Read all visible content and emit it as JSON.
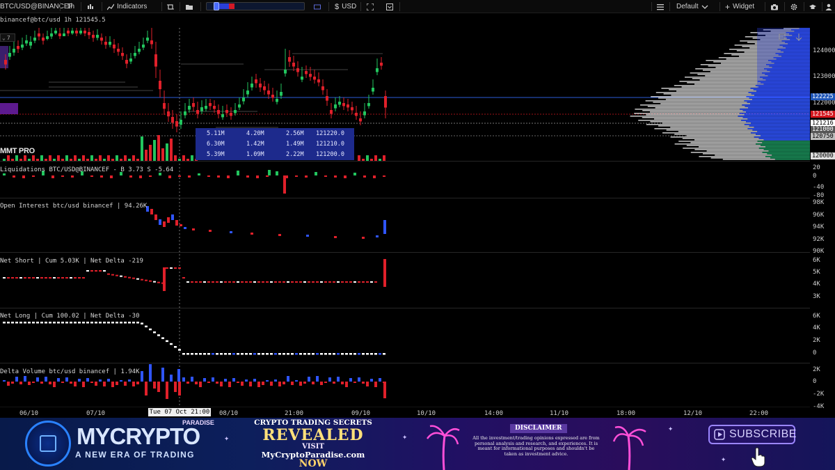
{
  "toolbar": {
    "symbol": "BTC/USD@BINANCEF",
    "interval": "1h",
    "indicators_label": "Indicators",
    "currency_label": "USD",
    "layout_label": "Default",
    "widget_label": "Widget"
  },
  "chart_header": {
    "symbol_line": "binancef@btc/usd 1h 121545.5",
    "collapse_count": "7",
    "watermark": "MMT PRO"
  },
  "price_axis": {
    "ticks": [
      "124000",
      "123000",
      "122000",
      "120000"
    ],
    "tags": [
      {
        "value": "122225",
        "bg": "#1f56b8",
        "fg": "#ffffff"
      },
      {
        "value": "121545",
        "bg": "#d4161e",
        "fg": "#ffffff"
      },
      {
        "value": "121216",
        "bg": "#ffffff",
        "fg": "#000000"
      },
      {
        "value": "121000",
        "bg": "#555555",
        "fg": "#ffffff"
      },
      {
        "value": "120750",
        "bg": "#bbbbbb",
        "fg": "#000000"
      },
      {
        "value": "120000",
        "bg": "#dddddd",
        "fg": "#000000"
      }
    ]
  },
  "orderbook_tooltip": {
    "rows": [
      [
        "5.11M",
        "4.20M",
        "2.56M",
        "121220.0"
      ],
      [
        "6.30M",
        "1.42M",
        "1.49M",
        "121210.0"
      ],
      [
        "5.39M",
        "1.09M",
        "2.22M",
        "121200.0"
      ]
    ]
  },
  "panes": {
    "liquidations": {
      "label": "Liquidations BTC/USD@BINANCEF - B 3.73 S -5.64",
      "ticks": [
        "20",
        "0",
        "-40",
        "-80"
      ]
    },
    "open_interest": {
      "label": "Open Interest btc/usd binancef | 94.26K",
      "ticks": [
        "98K",
        "96K",
        "94K",
        "92K",
        "90K"
      ]
    },
    "net_short": {
      "label": "Net Short | Cum 5.03K | Net Delta -219",
      "ticks": [
        "6K",
        "5K",
        "4K",
        "3K"
      ]
    },
    "net_long": {
      "label": "Net Long | Cum 100.02 | Net Delta -30",
      "ticks": [
        "6K",
        "4K",
        "2K",
        "0"
      ]
    },
    "delta_volume": {
      "label": "Delta Volume btc/usd binancef | 1.94K",
      "ticks": [
        "2K",
        "0",
        "-2K",
        "-4K"
      ]
    }
  },
  "time_axis": {
    "labels": [
      "06/10",
      "07/10",
      "08/10",
      "21:00",
      "09/10",
      "10/10",
      "14:00",
      "11/10",
      "18:00",
      "12/10",
      "22:00"
    ],
    "cursor_label": "Tue 07 Oct 21:00"
  },
  "banner": {
    "brand": "MYCRYPTO",
    "brand_sub": "PARADISE",
    "tagline": "A NEW ERA OF TRADING",
    "promo_title": "CRYPTO TRADING SECRETS",
    "promo_headline": "REVEALED",
    "promo_visit": "VISIT",
    "promo_url": "MyCryptoParadise.com",
    "promo_now": "NOW",
    "disclaimer_title": "DISCLAIMER",
    "disclaimer_text": "All the investment/trading opinions expressed are from personal analysis and research, and experiences. It is meant for informational purposes and shouldn't be taken as investment advice.",
    "subscribe_label": "SUBSCRIBE"
  },
  "colors": {
    "bull": "#22c55e",
    "bear": "#e0202a",
    "blue": "#2f55ff",
    "background": "#000000"
  }
}
